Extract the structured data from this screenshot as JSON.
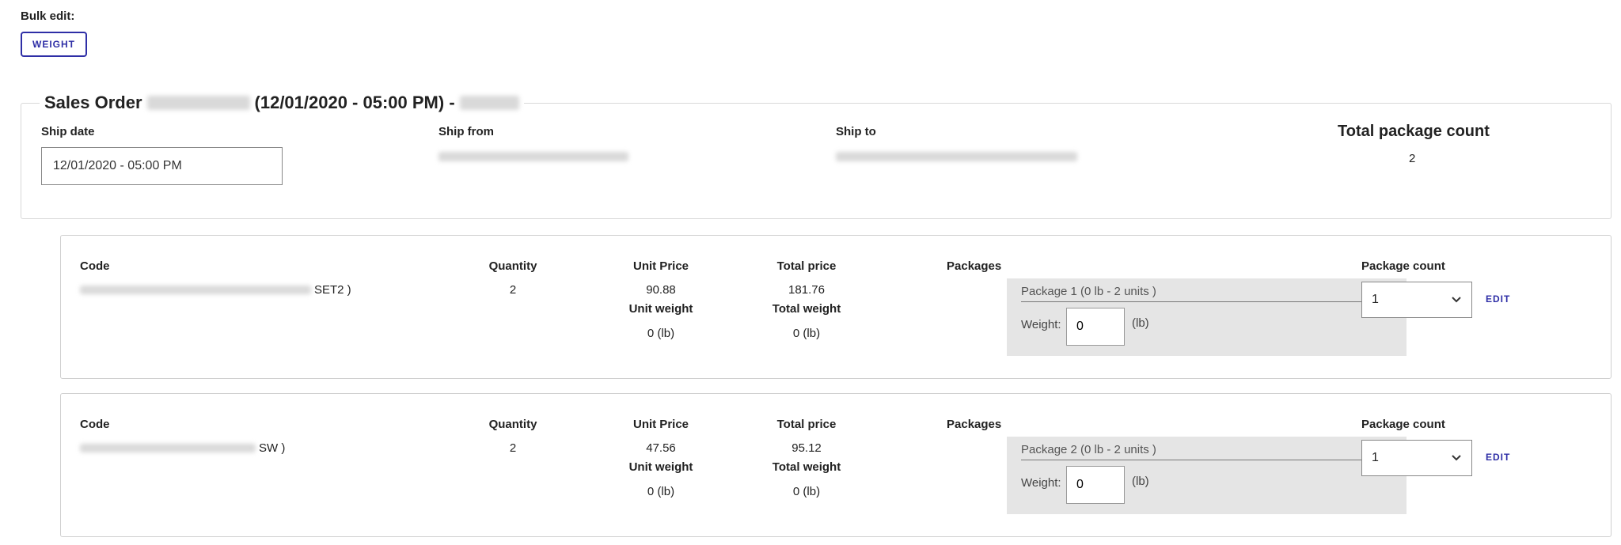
{
  "bulk": {
    "label": "Bulk edit:",
    "weight_button": "WEIGHT"
  },
  "order": {
    "title_prefix": "Sales Order",
    "title_date": "(12/01/2020 - 05:00 PM) -",
    "ship_date_label": "Ship date",
    "ship_date_value": "12/01/2020 - 05:00 PM",
    "ship_from_label": "Ship from",
    "ship_to_label": "Ship to",
    "total_package_count_label": "Total package count",
    "total_package_count_value": "2"
  },
  "items": [
    {
      "code_label": "Code",
      "code_suffix": "SET2 )",
      "quantity_label": "Quantity",
      "quantity": "2",
      "unit_price_label": "Unit Price",
      "unit_price": "90.88",
      "total_price_label": "Total price",
      "total_price": "181.76",
      "unit_weight_label": "Unit weight",
      "unit_weight": "0 (lb)",
      "total_weight_label": "Total weight",
      "total_weight": "0 (lb)",
      "packages_label": "Packages",
      "package_title": "Package 1 (0 lb - 2 units )",
      "weight_label": "Weight:",
      "weight_value": "0",
      "weight_unit": "(lb)",
      "package_count_label": "Package count",
      "package_count": "1",
      "edit_label": "EDIT"
    },
    {
      "code_label": "Code",
      "code_suffix": "SW )",
      "quantity_label": "Quantity",
      "quantity": "2",
      "unit_price_label": "Unit Price",
      "unit_price": "47.56",
      "total_price_label": "Total price",
      "total_price": "95.12",
      "unit_weight_label": "Unit weight",
      "unit_weight": "0 (lb)",
      "total_weight_label": "Total weight",
      "total_weight": "0 (lb)",
      "packages_label": "Packages",
      "package_title": "Package 2 (0 lb - 2 units )",
      "weight_label": "Weight:",
      "weight_value": "0",
      "weight_unit": "(lb)",
      "package_count_label": "Package count",
      "package_count": "1",
      "edit_label": "EDIT"
    }
  ],
  "icons": {
    "select_arrow": "chevron-down-icon"
  },
  "colors": {
    "accent": "#2e2ea6",
    "panel": "#e5e5e5",
    "border": "#d0d0d0"
  }
}
